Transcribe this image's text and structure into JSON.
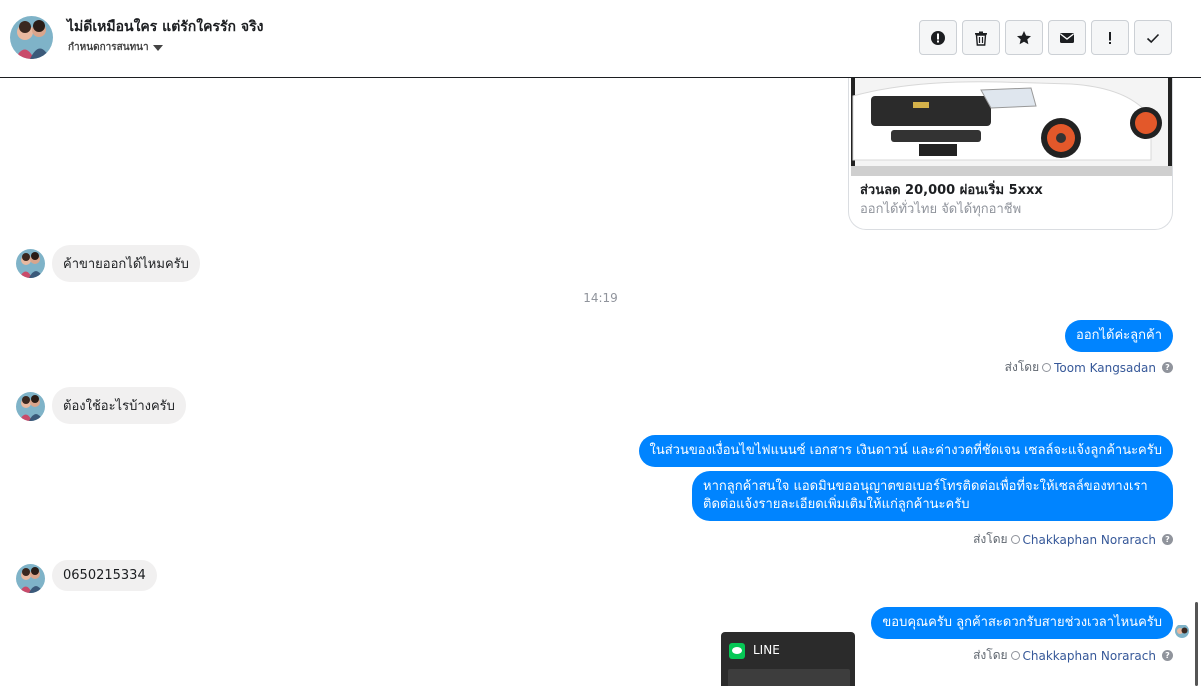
{
  "header": {
    "title": "ไม่ดีเหมือนใคร แต่รักใครรัก จริง",
    "subtitle": "กำหนดการสนทนา",
    "toolbar": [
      {
        "icon": "alert-circle-icon"
      },
      {
        "icon": "trash-icon"
      },
      {
        "icon": "star-icon"
      },
      {
        "icon": "envelope-icon"
      },
      {
        "icon": "exclamation-icon"
      },
      {
        "icon": "check-icon"
      }
    ]
  },
  "ad_card": {
    "title": "ส่วนลด 20,000 ผ่อนเริ่ม 5xxx",
    "subtitle": "ออกได้ทั่วไทย จัดได้ทุกอาชีพ"
  },
  "messages": {
    "m1": "ค้าขายออกได้ไหมครับ",
    "timestamp": "14:19",
    "m2": "ออกได้ค่ะลูกค้า",
    "m2_sent_prefix": "ส่งโดย",
    "m2_sender": "Toom Kangsadan",
    "m3": "ต้องใช้อะไรบ้างครับ",
    "m4": "ในส่วนของเงื่อนไขไฟแนนซ์ เอกสาร เงินดาวน์ และค่างวดที่ชัดเจน เซลล์จะแจ้งลูกค้านะครับ",
    "m5": "หากลูกค้าสนใจ แอดมินขออนุญาตขอเบอร์โทรติดต่อเพื่อที่จะให้เซลล์ของทางเราติดต่อแจ้งรายละเอียดเพิ่มเติมให้แก่ลูกค้านะครับ",
    "m5_sent_prefix": "ส่งโดย",
    "m5_sender": "Chakkaphan Norarach",
    "m6": "0650215334",
    "m7": "ขอบคุณครับ ลูกค้าสะดวกรับสายช่วงเวลาไหนครับ",
    "m7_sent_prefix": "ส่งโดย",
    "m7_sender": "Chakkaphan Norarach"
  },
  "line_popup": {
    "label": "LINE"
  },
  "colors": {
    "outgoing_bubble": "#0084ff",
    "incoming_bubble": "#f1f0f0",
    "sender_link": "#365899"
  }
}
